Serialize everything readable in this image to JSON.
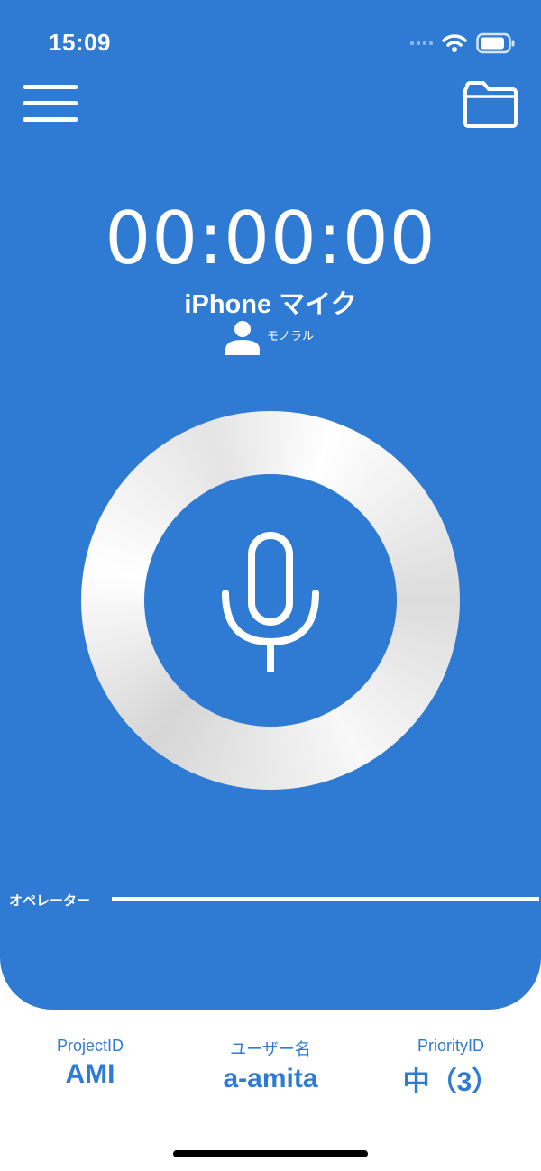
{
  "status_bar": {
    "time": "15:09"
  },
  "header": {
    "menu_icon": "hamburger-icon",
    "folder_icon": "folder-icon"
  },
  "recorder": {
    "timer": "00:00:00",
    "device": "iPhone マイク",
    "channel": "モノラル",
    "mic_icon": "microphone-icon"
  },
  "operator": {
    "label": "オペレーター"
  },
  "footer": {
    "project": {
      "label": "ProjectID",
      "value": "AMI"
    },
    "user": {
      "label": "ユーザー名",
      "value": "a-amita"
    },
    "priority": {
      "label": "PriorityID",
      "value": "中（3）"
    }
  },
  "colors": {
    "primary": "#2f7bd4",
    "white": "#ffffff"
  }
}
